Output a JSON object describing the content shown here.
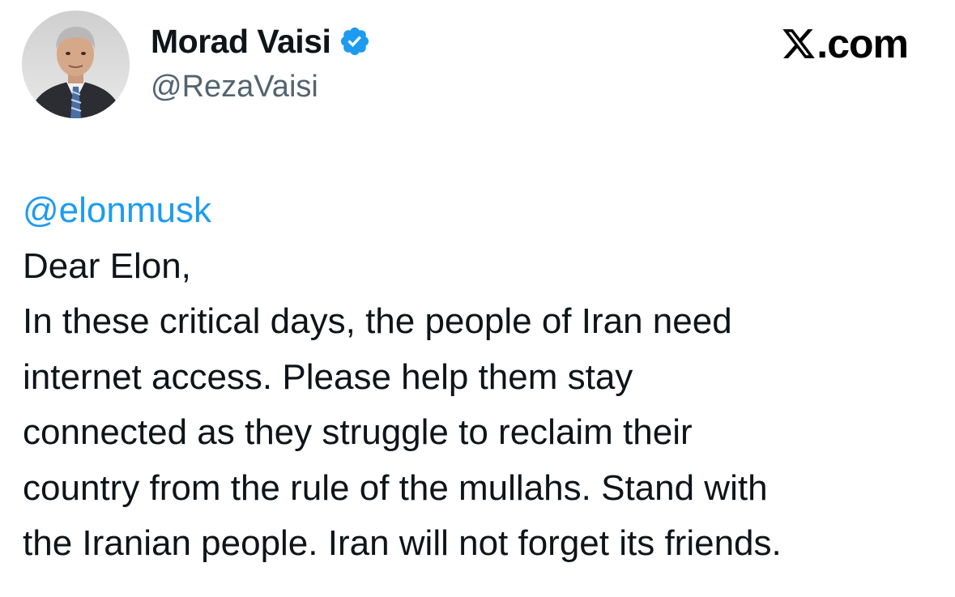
{
  "author": {
    "display_name": "Morad Vaisi",
    "handle": "@RezaVaisi",
    "verified": true,
    "avatar_icon": "profile-photo",
    "verified_icon": "verified-badge-icon"
  },
  "brand": {
    "logo_icon": "x-logo-icon",
    "domain_suffix": ".com"
  },
  "tweet": {
    "mention": "@elonmusk",
    "lines": [
      "Dear Elon,",
      "In these critical days, the people of Iran need",
      "internet access. Please help them stay",
      "connected as they struggle to reclaim their",
      "country from the rule of the mullahs. Stand with",
      "the Iranian people. Iran will not forget its friends."
    ]
  },
  "colors": {
    "link": "#1d9bf0",
    "text": "#0f1419",
    "secondary": "#536471",
    "verified_badge": "#1d9bf0",
    "background": "#ffffff"
  }
}
